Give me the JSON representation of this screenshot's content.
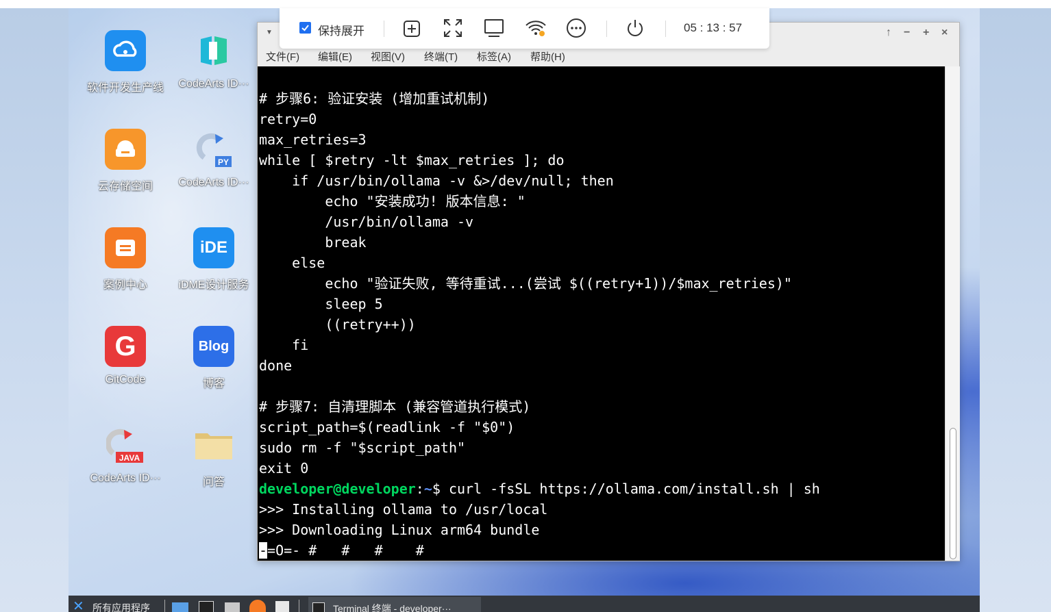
{
  "desktop": {
    "icons": [
      {
        "label": "软件开发生产线",
        "icon": "cloud-pipeline-icon",
        "color": "#1f8ff0"
      },
      {
        "label": "CodeArts ID···",
        "icon": "codearts-ide-icon",
        "color": "#20b9d6"
      },
      {
        "label": "云存储空间",
        "icon": "cloud-storage-icon",
        "color": "#f7962b"
      },
      {
        "label": "CodeArts ID···",
        "icon": "codearts-py-icon",
        "color": "#3f7fe0"
      },
      {
        "label": "案例中心",
        "icon": "case-center-icon",
        "color": "#f57a24"
      },
      {
        "label": "iDME设计服务",
        "icon": "idme-icon",
        "color": "#1f8ff0"
      },
      {
        "label": "GitCode",
        "icon": "gitcode-icon",
        "color": "#e8393a"
      },
      {
        "label": "博客",
        "icon": "blog-icon",
        "color": "#2d6fe8"
      },
      {
        "label": "CodeArts ID···",
        "icon": "codearts-java-icon",
        "color": "#e8393a"
      },
      {
        "label": "问答",
        "icon": "folder-icon",
        "color": "#e9cf86"
      }
    ]
  },
  "toolbar": {
    "keep_expanded_label": "保持展开",
    "keep_expanded_checked": true,
    "timer": "05 : 13 : 57",
    "icons": [
      "add-window-icon",
      "fullscreen-icon",
      "display-icon",
      "wifi-icon",
      "more-icon",
      "power-icon"
    ]
  },
  "terminal": {
    "menu": [
      "文件(F)",
      "编辑(E)",
      "视图(V)",
      "终端(T)",
      "标签(A)",
      "帮助(H)"
    ],
    "lines": [
      "# 步骤6: 验证安装 (增加重试机制)",
      "retry=0",
      "max_retries=3",
      "while [ $retry -lt $max_retries ]; do",
      "    if /usr/bin/ollama -v &>/dev/null; then",
      "        echo \"安装成功! 版本信息: \"",
      "        /usr/bin/ollama -v",
      "        break",
      "    else",
      "        echo \"验证失败, 等待重试...(尝试 $((retry+1))/$max_retries)\"",
      "        sleep 5",
      "        ((retry++))",
      "    fi",
      "done",
      "",
      "# 步骤7: 自清理脚本 (兼容管道执行模式)",
      "script_path=$(readlink -f \"$0\")",
      "sudo rm -f \"$script_path\"",
      "exit 0"
    ],
    "prompt_user": "developer@developer",
    "prompt_path": "~",
    "prompt_symbol": "$",
    "command": " curl -fsSL https://ollama.com/install.sh | sh",
    "output": [
      ">>> Installing ollama to /usr/local",
      ">>> Downloading Linux arm64 bundle"
    ],
    "progress_line": "=O=- #   #   #    #",
    "colors": {
      "prompt_user": "#00d75f",
      "prompt_path": "#5c8cf0"
    }
  },
  "taskbar": {
    "start_label": "所有应用程序",
    "window_label": "Terminal 终端 - developer···"
  }
}
